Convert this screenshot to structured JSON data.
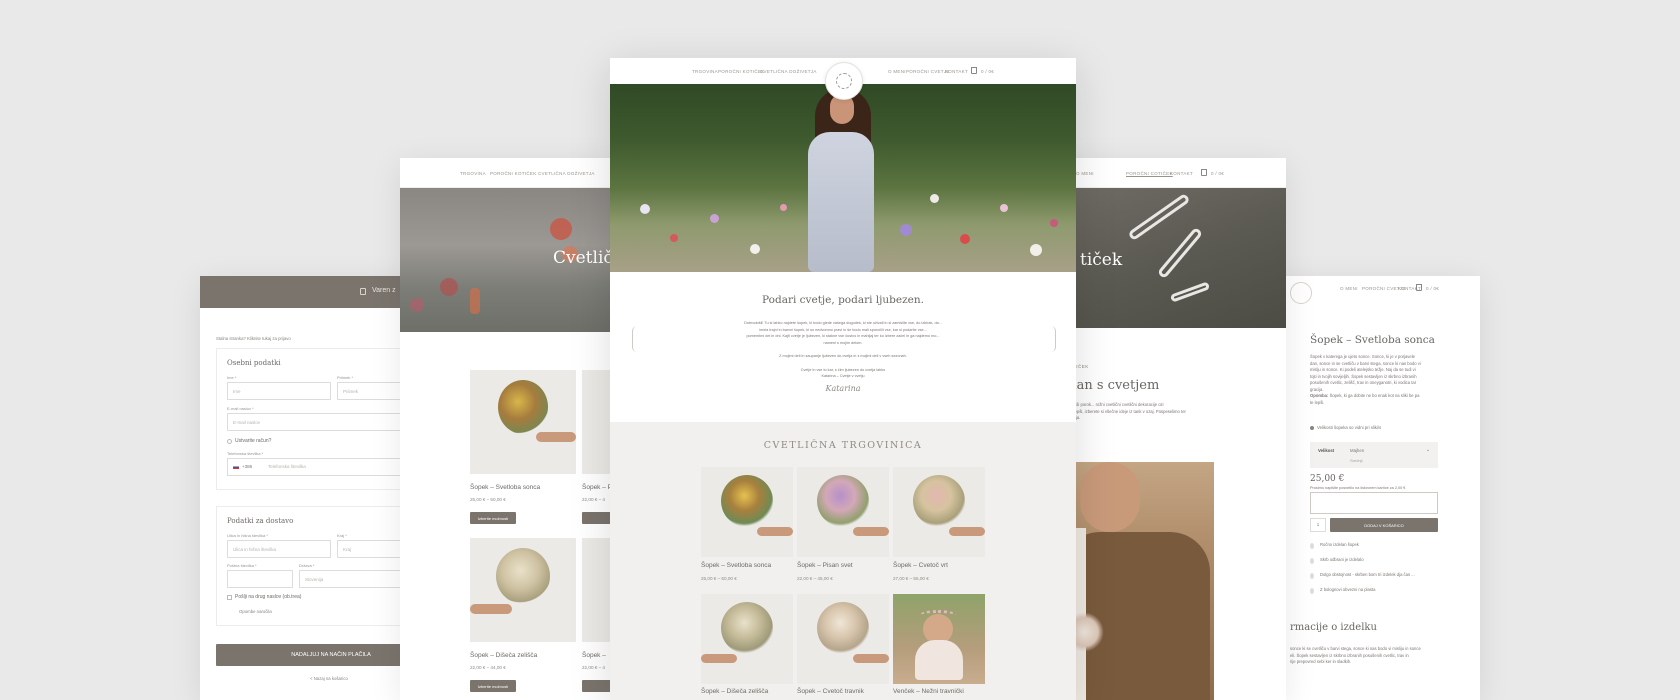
{
  "brand": {
    "accent": "#7a746d",
    "bg": "#e9e9e9"
  },
  "checkout": {
    "header_title": "Varen z",
    "top_note": "Stalna stranka? Kliknite tukaj za prijavo",
    "personal_title": "Osebni podatki",
    "first_name_label": "Ime *",
    "first_name_ph": "Ime",
    "last_name_label": "Priimek *",
    "last_name_ph": "Priimek",
    "email_label": "E-mail naslov *",
    "email_ph": "E-mail naslov",
    "create_account": "Ustvarite račun?",
    "phone_label": "Telefonska številka *",
    "phone_code": "+386",
    "phone_ph": "Telefonska številka",
    "delivery_title": "Podatki za dostavo",
    "street_label": "Ulica in hišna številka *",
    "street_ph": "Ulica in hišna številka",
    "city_label": "Kraj *",
    "city_ph": "Kraj",
    "postal_label": "Poštna številka *",
    "country_label": "Država *",
    "country_ph": "Slovenija",
    "other_address": "Pošlji na drug naslov (ob.trea)",
    "notes_label": "Opombe naročila",
    "continue_btn": "NADALJUJ NA NAČIN PLAČILA",
    "back_link": "< Nazaj na košarico"
  },
  "shop": {
    "nav": [
      "TRGOVINA",
      "POROČNI KOTIČEK",
      "CVETLIČNA DOŽIVETJA"
    ],
    "hero_title": "Cvetlič",
    "btn": "Izberite možnosti",
    "products": [
      {
        "name": "Šopek – Svetloba sonca",
        "price": "25,00 € – 50,00 €"
      },
      {
        "name": "Šopek – P",
        "price": "22,00 € – 4"
      },
      {
        "name": "Šopek – Dišeča zeliščа",
        "price": "22,00 € – 44,00 €"
      },
      {
        "name": "Šopek – ",
        "price": "22,00 € – 4"
      }
    ]
  },
  "wedding": {
    "nav": [
      "O MENI",
      "POROČNI COTIČEK",
      "KONTAKT"
    ],
    "cart_label": "0 / 0€",
    "hero_title": "tiček",
    "section_label": "R KOTIČEK",
    "heading": "i dan s cvetjem",
    "intro_lines": [
      "Vse o vaši porok... rožni cvetlični cvetlični dekoracije ozi",
      "dan še lepši, izberete si všečne ideje iz tank v ozaj. Pospeselimo ter",
      "dekoracija."
    ]
  },
  "product": {
    "nav": [
      "O MENI",
      "POROČNI CVETJE",
      "KONTAKT"
    ],
    "cart_label": "0 / 0€",
    "title": "Šopek – Svetloba sonca",
    "desc_lines": [
      "Šopek v katerega je ujeto sonce. Sonce, ki je v porjavele",
      "dan, sonce in se cvetliču v barvi stega, sonce ki nas bodo vi",
      "mislju in sonce. Ki podeli atelejsko težje. Naj da se tudi vi",
      "tojti in tvojih sovijeljih. Šopek sestavljen iz skrbno izbranih",
      "posušenih cvetlic, zelišč, trav in oneyganotri, ki vodica tar",
      "gracija."
    ],
    "note_label": "Opomba:",
    "note_text": "Šopek, ki ga dobite ne bo enak kot na sliki be pa",
    "note_text2": "te lepši.",
    "option_line": "Velikosti šopeka so vidni pri sliki/s",
    "size_label": "Velikost",
    "size_value": "Majhen",
    "size_hint": "Srednji",
    "price": "25,00 €",
    "message_label": "Prosimo napišite posvetilo na listovnem kartice za 2,00 €",
    "qty": "1",
    "add_btn": "DODAJ V KOŠARICO",
    "features": [
      "Ročno izdelan šopek",
      "Skrb odbrani je izdelalo",
      "Dolgo obstojnost - skrben bom tri izdelek dja čas ...",
      "Z bolognovi obvezni na plasta"
    ],
    "info_title": "rmacije o izdelku",
    "info_lines": [
      "sonce ki se cvetliču v barvi stega, sonce ki nas bodo vi misliju in sonce",
      "eli. Šopek sestavljen iz skrbno izbranih posušenih cvetlic, trav in",
      "",
      "rije prepovred sebi ker in sladkih."
    ]
  },
  "home": {
    "nav_left": [
      "TRGOVINA",
      "POROČNI KOTIČEK",
      "CVETLIČNA DOŽIVETJA"
    ],
    "nav_right": [
      "O MENI",
      "POROČNI CVETJE",
      "KONTAKT"
    ],
    "cart_label": "0 / 0€",
    "headline": "Podari cvetje, podari ljubezen.",
    "intro_lines": [
      "Dobrodošli! Tu si lahko najdete šopek, ki bodo glede vašega dogodek, ki ste uživali in si zamislite vse, do izbirak, da...",
      "imela trajni in barvni šopek, ki so nedvomno pravi in še bodo mali sporočili vse, kar si podarite vse...",
      "pomembni del in dni. Kajti cvetje je ljubezen, ki stakne vse čustvo in mahljaj ter ko izbere začel in ga najdemo mo...",
      "nameni s mojim delom."
    ],
    "intro_line2": "Z mojimi deli in zaupanje ljubezen do cvetja in z mojimi deli v vseh sezonah.",
    "intro_line3": "Cvetje in vse to kar, s čim ljubezen do cvetja lahko",
    "intro_line4": "Katarina – Cvetje v cvetju",
    "signature": "Katarina",
    "shop_title": "CVETLIČNA TRGOVINICA",
    "products": [
      {
        "name": "Šopek – Svetloba sonca",
        "price": "25,00 € – 50,00 €"
      },
      {
        "name": "Šopek – Pisan svet",
        "price": "22,00 € – 45,00 €"
      },
      {
        "name": "Šopek – Cvetoč vrt",
        "price": "27,00 € – 55,00 €"
      },
      {
        "name": "Šopek – Dišeča zelišča",
        "price": ""
      },
      {
        "name": "Šopek – Cvetoč travnik",
        "price": ""
      },
      {
        "name": "Venček – Nežni travnički",
        "price": ""
      }
    ]
  }
}
